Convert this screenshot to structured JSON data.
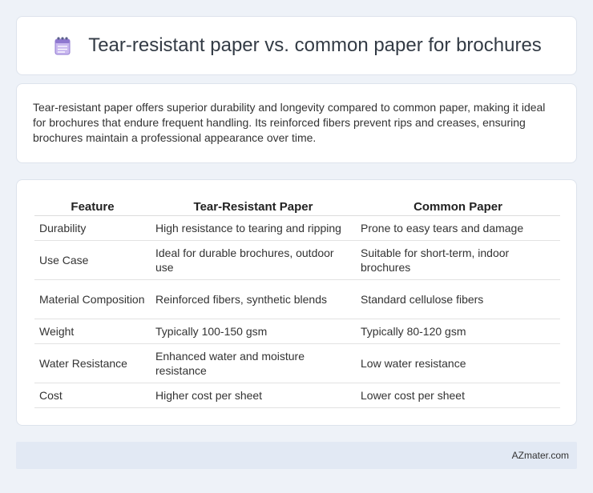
{
  "header": {
    "icon": "spiral-notepad-icon",
    "title": "Tear-resistant paper vs. common paper for brochures"
  },
  "summary": {
    "text": "Tear-resistant paper offers superior durability and longevity compared to common paper, making it ideal for brochures that endure frequent handling. Its reinforced fibers prevent rips and creases, ensuring brochures maintain a professional appearance over time."
  },
  "table": {
    "headers": [
      "Feature",
      "Tear-Resistant Paper",
      "Common Paper"
    ],
    "rows": [
      [
        "Durability",
        "High resistance to tearing and ripping",
        "Prone to easy tears and damage"
      ],
      [
        "Use Case",
        "Ideal for durable brochures, outdoor use",
        "Suitable for short-term, indoor brochures"
      ],
      [
        "Material Composition",
        "Reinforced fibers, synthetic blends",
        "Standard cellulose fibers"
      ],
      [
        "Weight",
        "Typically 100-150 gsm",
        "Typically 80-120 gsm"
      ],
      [
        "Water Resistance",
        "Enhanced water and moisture resistance",
        "Low water resistance"
      ],
      [
        "Cost",
        "Higher cost per sheet",
        "Lower cost per sheet"
      ]
    ]
  },
  "footer": {
    "text": "AZmater.com"
  }
}
